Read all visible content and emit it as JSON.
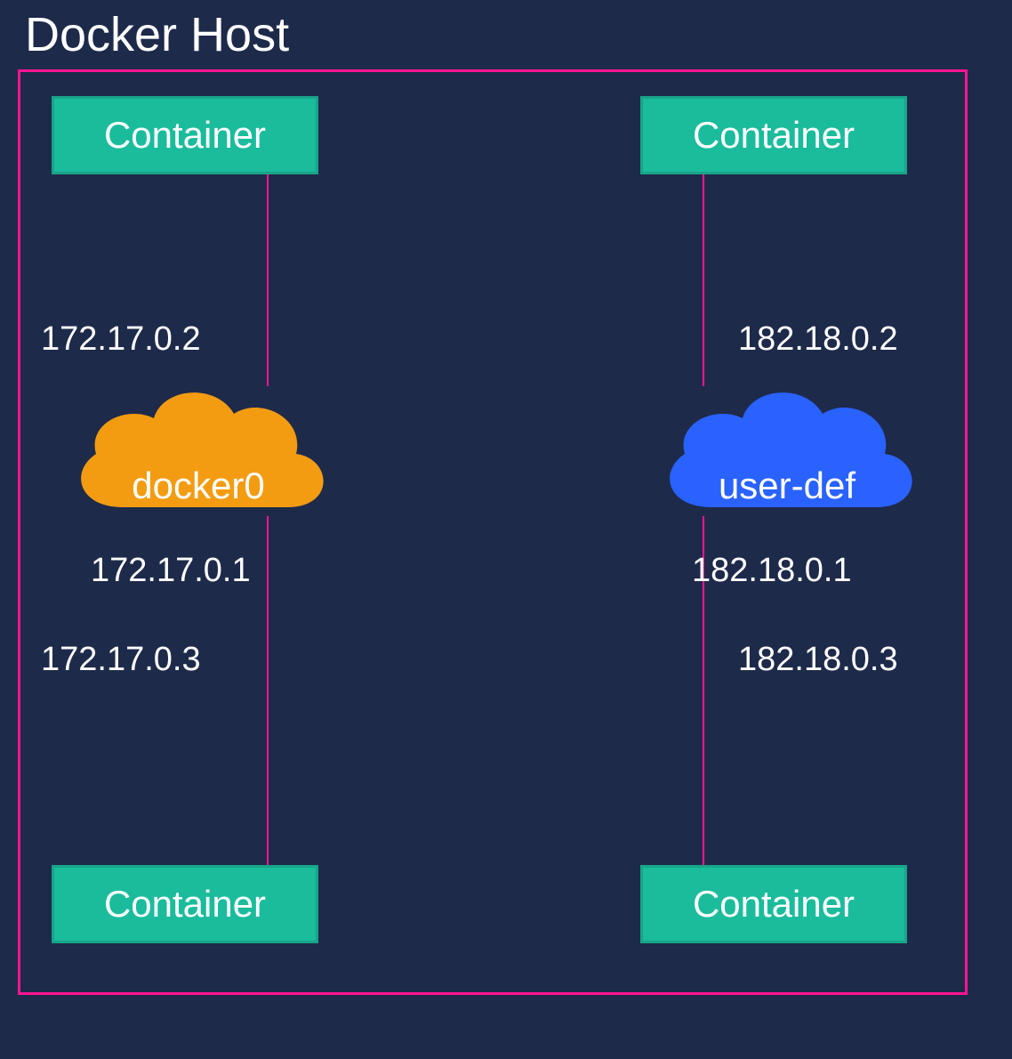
{
  "title": "Docker Host",
  "containers": {
    "top_left": "Container",
    "top_right": "Container",
    "bottom_left": "Container",
    "bottom_right": "Container"
  },
  "networks": {
    "left": {
      "name": "docker0",
      "color": "#f39c12",
      "gateway": "172.17.0.1",
      "ip_top": "172.17.0.2",
      "ip_bottom": "172.17.0.3"
    },
    "right": {
      "name": "user-def",
      "color": "#2962ff",
      "gateway": "182.18.0.1",
      "ip_top": "182.18.0.2",
      "ip_bottom": "182.18.0.3"
    }
  },
  "colors": {
    "background": "#1e2a4a",
    "frame": "#ff1493",
    "container_fill": "#1abc9c",
    "container_border": "#17a589"
  }
}
